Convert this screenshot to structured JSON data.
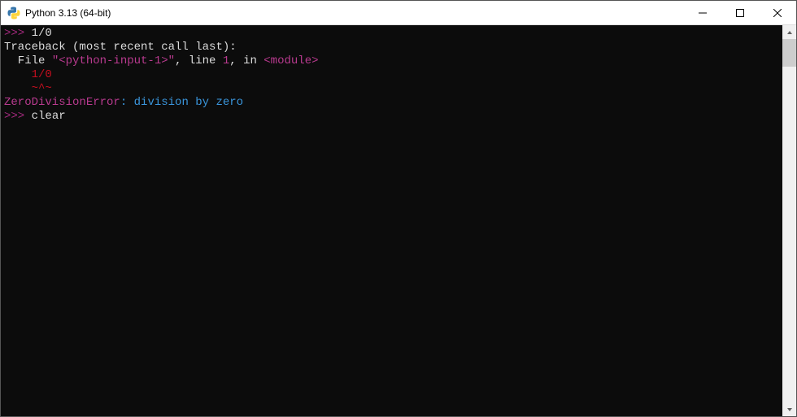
{
  "window": {
    "title": "Python 3.13 (64-bit)"
  },
  "console": {
    "line1_prompt": ">>>",
    "line1_expr": " 1/0",
    "line2": "Traceback (most recent call last):",
    "line3_a": "  File ",
    "line3_fname": "\"<python-input-1>\"",
    "line3_b": ", line ",
    "line3_lineno": "1",
    "line3_c": ", in ",
    "line3_mod": "<module>",
    "line4": "    1/0",
    "line5": "    ~^~",
    "line6_err": "ZeroDivisionError",
    "line6_sep": ": ",
    "line6_msg": "division by zero",
    "line7_prompt": ">>>",
    "line7_cmd": " clear"
  }
}
